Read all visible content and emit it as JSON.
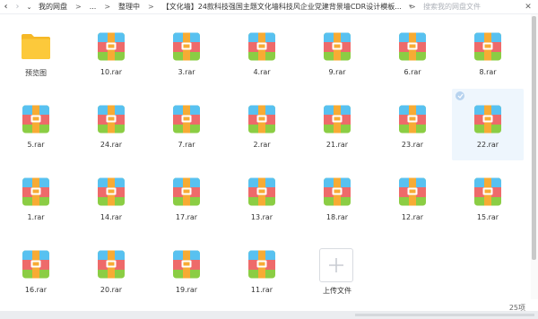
{
  "toolbar": {
    "back_icon": "chevron-left",
    "forward_icon": "chevron-right",
    "dropdown_icon": "chevron-down",
    "breadcrumbs": [
      "我的网盘",
      "...",
      "整理中",
      "【文化墙】24款科技强国主题文化墙科技风企业党建背景墙CDR设计模板..."
    ],
    "search_placeholder": "搜索我的网盘文件",
    "close_icon": "close"
  },
  "items": [
    {
      "label": "预览图",
      "type": "folder"
    },
    {
      "label": "10.rar",
      "type": "rar"
    },
    {
      "label": "3.rar",
      "type": "rar"
    },
    {
      "label": "4.rar",
      "type": "rar"
    },
    {
      "label": "9.rar",
      "type": "rar"
    },
    {
      "label": "6.rar",
      "type": "rar"
    },
    {
      "label": "8.rar",
      "type": "rar"
    },
    {
      "label": "5.rar",
      "type": "rar"
    },
    {
      "label": "24.rar",
      "type": "rar"
    },
    {
      "label": "7.rar",
      "type": "rar"
    },
    {
      "label": "2.rar",
      "type": "rar"
    },
    {
      "label": "21.rar",
      "type": "rar"
    },
    {
      "label": "23.rar",
      "type": "rar"
    },
    {
      "label": "22.rar",
      "type": "rar",
      "selected": true
    },
    {
      "label": "1.rar",
      "type": "rar"
    },
    {
      "label": "14.rar",
      "type": "rar"
    },
    {
      "label": "17.rar",
      "type": "rar"
    },
    {
      "label": "13.rar",
      "type": "rar"
    },
    {
      "label": "18.rar",
      "type": "rar"
    },
    {
      "label": "12.rar",
      "type": "rar"
    },
    {
      "label": "15.rar",
      "type": "rar"
    },
    {
      "label": "16.rar",
      "type": "rar"
    },
    {
      "label": "20.rar",
      "type": "rar"
    },
    {
      "label": "19.rar",
      "type": "rar"
    },
    {
      "label": "11.rar",
      "type": "rar"
    },
    {
      "label": "上传文件",
      "type": "upload"
    }
  ],
  "status": {
    "count": "25项"
  },
  "colors": {
    "folder": "#fcc93b",
    "rar_top": "#58c1f0",
    "rar_mid": "#ee6a6a",
    "rar_bottom": "#8bcd44",
    "rar_strap": "#f7ab34",
    "selection": "#eef6fd"
  }
}
